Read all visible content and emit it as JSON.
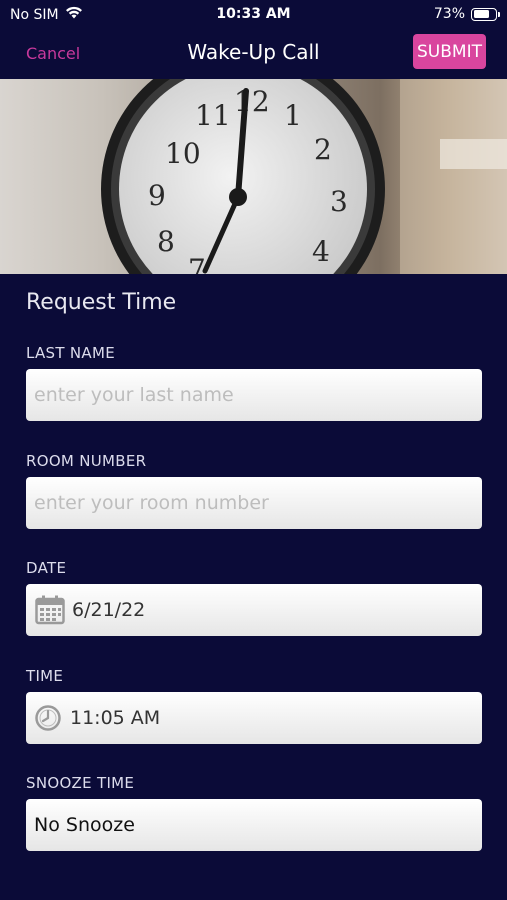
{
  "status_bar": {
    "carrier": "No SIM",
    "time": "10:33 AM",
    "battery_percent_label": "73%",
    "battery_level": 0.73
  },
  "nav": {
    "cancel_label": "Cancel",
    "title": "Wake-Up Call",
    "submit_label": "SUBMIT"
  },
  "form": {
    "section_title": "Request Time",
    "last_name": {
      "label": "LAST NAME",
      "placeholder": "enter your last name",
      "value": ""
    },
    "room_number": {
      "label": "ROOM NUMBER",
      "placeholder": "enter your room number",
      "value": ""
    },
    "date": {
      "label": "DATE",
      "value": "6/21/22",
      "icon": "calendar-icon"
    },
    "time": {
      "label": "TIME",
      "value": "11:05 AM",
      "icon": "clock-icon"
    },
    "snooze": {
      "label": "SNOOZE TIME",
      "value": "No Snooze"
    }
  },
  "colors": {
    "background": "#0b0b38",
    "accent": "#d9459e",
    "cancel": "#c8399c"
  }
}
